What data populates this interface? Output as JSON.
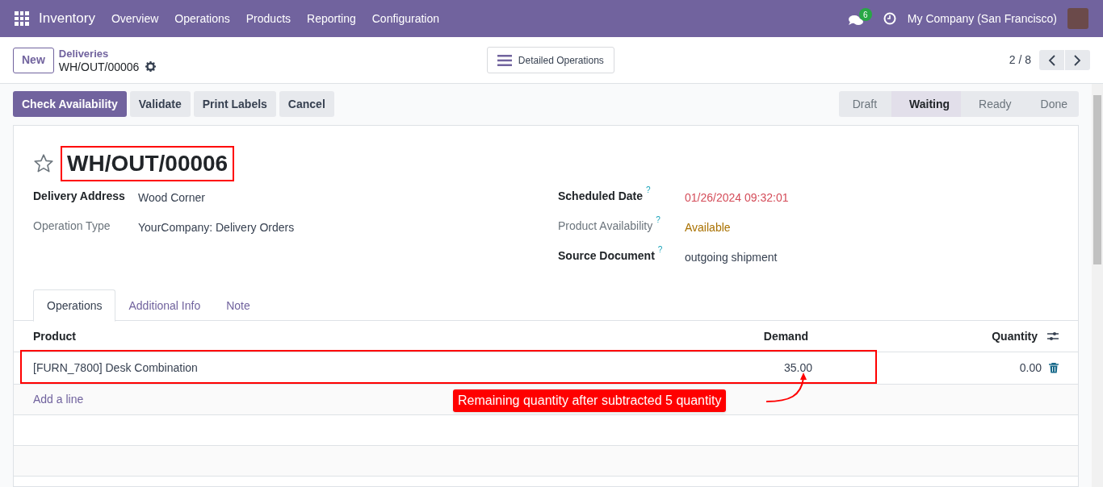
{
  "navbar": {
    "app": "Inventory",
    "menu": [
      "Overview",
      "Operations",
      "Products",
      "Reporting",
      "Configuration"
    ],
    "messages_badge": "6",
    "company": "My Company (San Francisco)"
  },
  "control_panel": {
    "new_button": "New",
    "breadcrumb": "Deliveries",
    "record": "WH/OUT/00006",
    "view_button": "Detailed Operations",
    "pager": "2 / 8"
  },
  "actions": [
    {
      "label": "Check Availability",
      "primary": true
    },
    {
      "label": "Validate",
      "primary": false
    },
    {
      "label": "Print Labels",
      "primary": false
    },
    {
      "label": "Cancel",
      "primary": false
    }
  ],
  "status_steps": [
    {
      "label": "Draft",
      "selected": false
    },
    {
      "label": "Waiting",
      "selected": true
    },
    {
      "label": "Ready",
      "selected": false
    },
    {
      "label": "Done",
      "selected": false
    }
  ],
  "form": {
    "title": "WH/OUT/00006",
    "starred": false,
    "left_fields": [
      {
        "label": "Delivery Address",
        "value": "Wood Corner",
        "required": true,
        "color": "#374151"
      },
      {
        "label": "Operation Type",
        "value": "YourCompany: Delivery Orders",
        "required": false,
        "color": "#374151"
      }
    ],
    "right_fields": [
      {
        "label": "Scheduled Date",
        "help": "?",
        "value": "01/26/2024 09:32:01",
        "required": true,
        "color": "#d44c59"
      },
      {
        "label": "Product Availability",
        "help": "?",
        "value": "Available",
        "required": false,
        "color": "#a97100"
      },
      {
        "label": "Source Document",
        "help": "?",
        "value": "outgoing shipment",
        "required": true,
        "color": "#374151"
      }
    ]
  },
  "tabs": [
    {
      "label": "Operations",
      "selected": true
    },
    {
      "label": "Additional Info",
      "selected": false
    },
    {
      "label": "Note",
      "selected": false
    }
  ],
  "table": {
    "columns": [
      "Product",
      "Demand",
      "Quantity"
    ],
    "rows": [
      {
        "product": "[FURN_7800] Desk Combination",
        "demand": "35.00",
        "quantity": "0.00"
      }
    ],
    "add_line": "Add a line"
  },
  "annotation": {
    "text": "Remaining quantity after subtracted 5 quantity"
  }
}
